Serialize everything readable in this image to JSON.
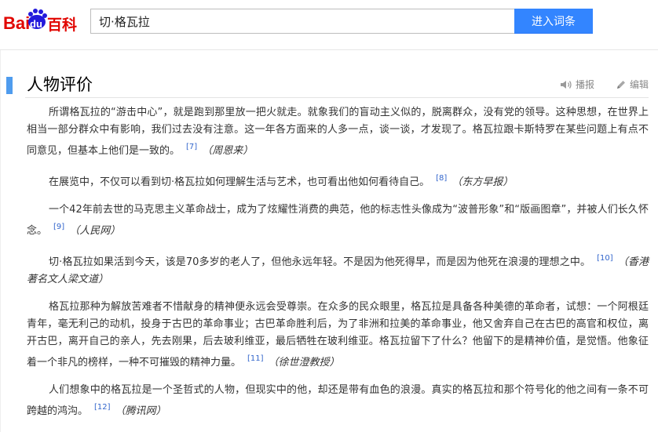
{
  "logo": {
    "part1": "Bai",
    "part2": "du",
    "part3": "百科"
  },
  "search": {
    "value": "切·格瓦拉",
    "button": "进入词条"
  },
  "section": {
    "title": "人物评价",
    "play_label": "播报",
    "edit_label": "编辑"
  },
  "paragraphs": [
    {
      "text": "所谓格瓦拉的“游击中心”，就是跑到那里放一把火就走。就象我们的盲动主义似的，脱离群众，没有党的领导。这种思想，在世界上相当一部分群众中有影响，我们过去没有注意。这一年各方面来的人多一点，谈一谈，才发现了。格瓦拉跟卡斯特罗在某些问题上有点不同意见，但基本上他们是一致的。",
      "ref": "[7]",
      "source": "（周恩来）"
    },
    {
      "text": "在展览中，不仅可以看到切·格瓦拉如何理解生活与艺术，也可看出他如何看待自己。",
      "ref": "[8]",
      "source": "（东方早报）"
    },
    {
      "text": "一个42年前去世的马克思主义革命战士，成为了炫耀性消费的典范，他的标志性头像成为“波普形象”和“版画图章”，并被人们长久怀念。",
      "ref": "[9]",
      "source": "（人民网）"
    },
    {
      "text": "切·格瓦拉如果活到今天，该是70多岁的老人了，但他永远年轻。不是因为他死得早，而是因为他死在浪漫的理想之中。",
      "ref": "[10]",
      "source": "（香港著名文人梁文道）"
    },
    {
      "text": "格瓦拉那种为解放苦难者不惜献身的精神便永远会受尊崇。在众多的民众眼里，格瓦拉是具备各种美德的革命者，试想：一个阿根廷青年，毫无利己的动机，投身于古巴的革命事业；古巴革命胜利后，为了非洲和拉美的革命事业，他又舍弃自己在古巴的高官和权位，离开古巴，离开自己的亲人，先去刚果，后去玻利维亚，最后牺牲在玻利维亚。格瓦拉留下了什么？他留下的是精神价值，是觉悟。他象征着一个非凡的榜样，一种不可摧毁的精神力量。",
      "ref": "[11]",
      "source": "（徐世澄教授）"
    },
    {
      "text": "人们想象中的格瓦拉是一个圣哲式的人物，但现实中的他，却还是带有血色的浪漫。真实的格瓦拉和那个符号化的他之间有一条不可跨越的鸿沟。",
      "ref": "[12]",
      "source": "（腾讯网）"
    }
  ]
}
